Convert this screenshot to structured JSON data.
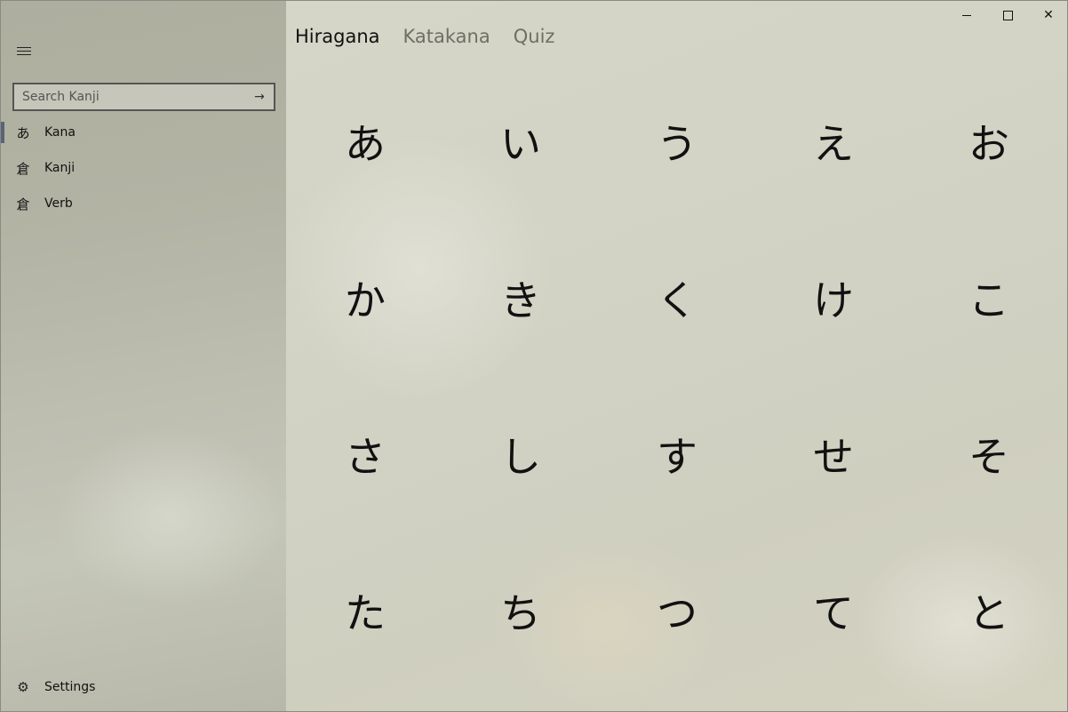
{
  "sidebar": {
    "search": {
      "placeholder": "Search Kanji",
      "go_icon": "→"
    },
    "items": [
      {
        "icon": "あ",
        "label": "Kana",
        "selected": true
      },
      {
        "icon": "倉",
        "label": "Kanji",
        "selected": false
      },
      {
        "icon": "倉",
        "label": "Verb",
        "selected": false
      }
    ],
    "settings": {
      "icon": "⚙",
      "label": "Settings"
    },
    "accent_color": "#5a6478"
  },
  "tabs": [
    {
      "label": "Hiragana",
      "active": true
    },
    {
      "label": "Katakana",
      "active": false
    },
    {
      "label": "Quiz",
      "active": false
    }
  ],
  "kana": [
    [
      "あ",
      "い",
      "う",
      "え",
      "お"
    ],
    [
      "か",
      "き",
      "く",
      "け",
      "こ"
    ],
    [
      "さ",
      "し",
      "す",
      "せ",
      "そ"
    ],
    [
      "た",
      "ち",
      "つ",
      "て",
      "と"
    ]
  ],
  "window_controls": {
    "close": "✕"
  }
}
